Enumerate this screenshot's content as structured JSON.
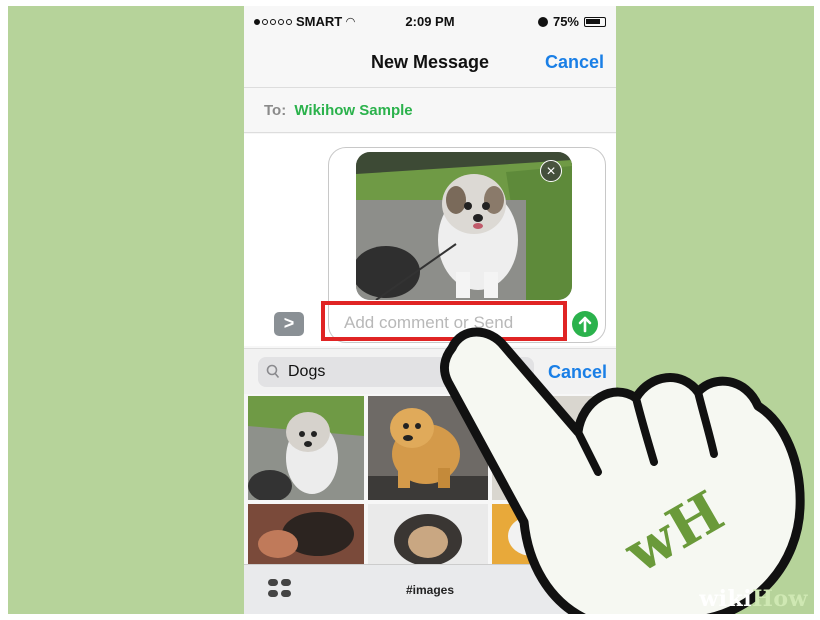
{
  "status_bar": {
    "carrier": "SMART",
    "time": "2:09 PM",
    "battery": "75%"
  },
  "nav": {
    "title": "New Message",
    "cancel_label": "Cancel"
  },
  "recipient": {
    "to_label": "To:",
    "name": "Wikihow Sample"
  },
  "compose": {
    "placeholder": "Add comment or Send",
    "expand_label": ">",
    "remove_label": "×"
  },
  "image_search": {
    "query": "Dogs",
    "cancel_label": "Cancel"
  },
  "bottom_bar": {
    "label": "#images"
  },
  "watermark": {
    "wiki": "wiki",
    "how": "How"
  },
  "logo": {
    "text": "wH"
  },
  "colors": {
    "background": "#b6d39a",
    "accent_blue": "#1a7fe6",
    "accent_green": "#2bb24c",
    "highlight_red": "#e02424"
  }
}
